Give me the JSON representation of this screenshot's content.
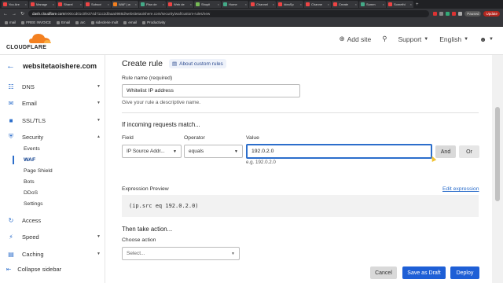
{
  "browser": {
    "tabs": [
      {
        "label": "You Are",
        "color": "#e44"
      },
      {
        "label": "Manage",
        "color": "#e44"
      },
      {
        "label": "Sharel",
        "color": "#e44"
      },
      {
        "label": "Subscri",
        "color": "#e44"
      },
      {
        "label": "WAF | w",
        "color": "#f38020",
        "active": true
      },
      {
        "label": "Plan de",
        "color": "#4a8"
      },
      {
        "label": "Web de",
        "color": "#e44"
      },
      {
        "label": "Shopif",
        "color": "#7b5"
      },
      {
        "label": "Home",
        "color": "#4a8"
      },
      {
        "label": "Channel",
        "color": "#e44"
      },
      {
        "label": "IdeaSp",
        "color": "#e44"
      },
      {
        "label": "Channe",
        "color": "#e44"
      },
      {
        "label": "Create",
        "color": "#e44"
      },
      {
        "label": "Summ",
        "color": "#4a8"
      },
      {
        "label": "Somethi",
        "color": "#e44"
      }
    ],
    "url_domain": "dash.cloudflare.com",
    "url_rest": "/e00ccd01c0fe374d711c2dfaaa0988d/websitetaoishere.com/security/waf/custom-rules/new",
    "profile": "Paused",
    "update": "Update",
    "bookmarks": [
      "mail",
      "FREE INVOICE",
      "Email",
      "arc",
      "sideclerie mult",
      "email",
      "Productivity"
    ]
  },
  "header": {
    "logo_text": "CLOUDFLARE",
    "add_site": "Add site",
    "support": "Support",
    "language": "English"
  },
  "sidebar": {
    "site_name": "websitetaoishere.com",
    "items": [
      {
        "label": "DNS"
      },
      {
        "label": "Email"
      },
      {
        "label": "SSL/TLS"
      },
      {
        "label": "Security"
      }
    ],
    "security_sub": [
      "Events",
      "WAF",
      "Page Shield",
      "Bots",
      "DDoS",
      "Settings"
    ],
    "more": [
      {
        "label": "Access"
      },
      {
        "label": "Speed"
      },
      {
        "label": "Caching"
      }
    ],
    "collapse": "Collapse sidebar"
  },
  "form": {
    "title": "Create rule",
    "about": "About custom rules",
    "rule_name_label": "Rule name (required)",
    "rule_name_value": "Whitelist IP address",
    "rule_name_help": "Give your rule a descriptive name.",
    "match_heading": "If incoming requests match...",
    "field_label": "Field",
    "operator_label": "Operator",
    "value_label": "Value",
    "field_value": "IP Source Addr...",
    "operator_value": "equals",
    "value_value": "192.0.2.0",
    "value_example": "e.g. 192.0.2.0",
    "and_label": "And",
    "or_label": "Or",
    "expr_label": "Expression Preview",
    "edit_expression": "Edit expression",
    "expression": "(ip.src eq 192.0.2.0)",
    "action_heading": "Then take action...",
    "action_label": "Choose action",
    "action_placeholder": "Select...",
    "cancel": "Cancel",
    "save_draft": "Save as Draft",
    "deploy": "Deploy"
  }
}
